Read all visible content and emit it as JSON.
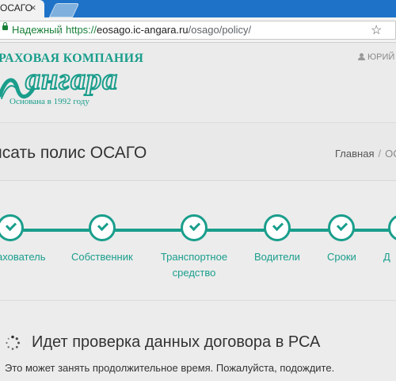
{
  "browser": {
    "tab_title": "ОСАГО",
    "tab_close": "×",
    "secure_label": "Надежный",
    "url": {
      "protocol": "https://",
      "host": "eosago.ic-angara.ru",
      "path": "/osago/policy/"
    },
    "bookmark_icon": "star-icon"
  },
  "header": {
    "logo_top": "РАХОВАЯ КОМПАНИЯ",
    "logo_name": "ангара",
    "logo_sub": "Основана в 1992 году",
    "user_link": "ЮРИЙ",
    "brand_color": "#1a9e8c"
  },
  "title": {
    "text": "исать полис ОСАГО",
    "breadcrumb_home": "Главная",
    "breadcrumb_sep": "/",
    "breadcrumb_current": "ОС"
  },
  "steps": {
    "items": [
      {
        "label": "ахователь",
        "done": true
      },
      {
        "label": "Собственник",
        "done": true
      },
      {
        "label": "Транспортное средство",
        "done": true
      },
      {
        "label": "Водители",
        "done": true
      },
      {
        "label": "Сроки",
        "done": true
      },
      {
        "label": "Д",
        "done": true
      }
    ]
  },
  "status": {
    "title": "Идет проверка данных договора в РСА",
    "description": "Это может занять продолжительное время. Пожалуйста, подождите.",
    "spinner_icon": "spinner-icon"
  }
}
